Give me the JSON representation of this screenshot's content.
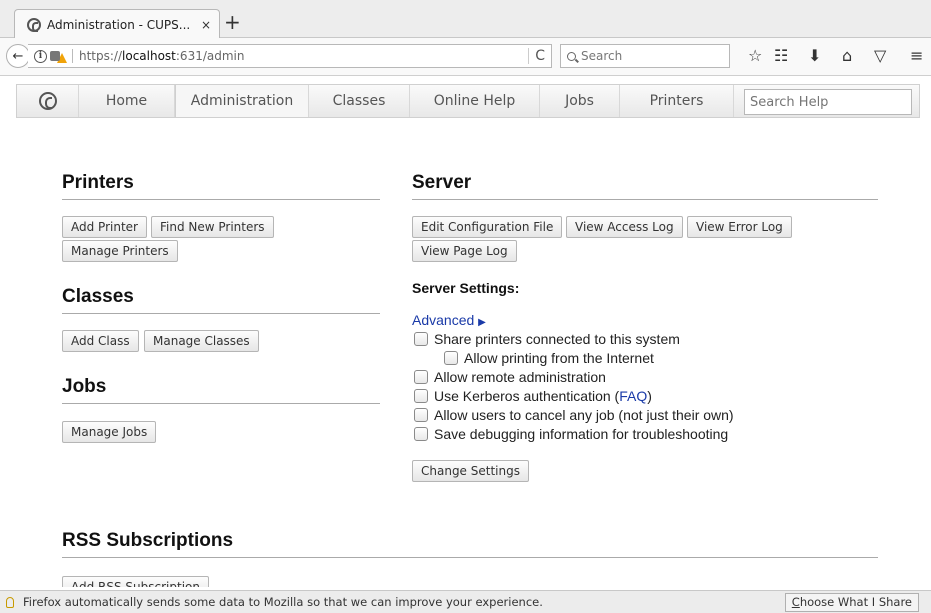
{
  "browser": {
    "tab_title": "Administration - CUPS...",
    "tab_close": "×",
    "new_tab": "+",
    "back": "🡐",
    "url_host": "localhost",
    "url_prefix": "https://",
    "url_suffix": ":631/admin",
    "reload": "C",
    "search_placeholder": "Search",
    "toolbar_icons": [
      "star-icon",
      "reading-list-icon",
      "download-icon",
      "home-icon",
      "pocket-icon",
      "menu-icon"
    ]
  },
  "cups_nav": {
    "tabs": [
      "Home",
      "Administration",
      "Classes",
      "Online Help",
      "Jobs",
      "Printers"
    ],
    "active": "Administration",
    "search_placeholder": "Search Help"
  },
  "printers": {
    "heading": "Printers",
    "buttons": [
      "Add Printer",
      "Find New Printers",
      "Manage Printers"
    ]
  },
  "classes": {
    "heading": "Classes",
    "buttons": [
      "Add Class",
      "Manage Classes"
    ]
  },
  "jobs": {
    "heading": "Jobs",
    "buttons": [
      "Manage Jobs"
    ]
  },
  "server": {
    "heading": "Server",
    "buttons": [
      "Edit Configuration File",
      "View Access Log",
      "View Error Log",
      "View Page Log"
    ],
    "settings_heading": "Server Settings:",
    "advanced_link": "Advanced",
    "advanced_arrow": "▶",
    "options": [
      "Share printers connected to this system",
      "Allow printing from the Internet",
      "Allow remote administration",
      "Use Kerberos authentication (",
      "Allow users to cancel any job (not just their own)",
      "Save debugging information for troubleshooting"
    ],
    "faq_link": "FAQ",
    "kerberos_close": ")",
    "change_button": "Change Settings"
  },
  "rss": {
    "heading": "RSS Subscriptions",
    "button": "Add RSS Subscription"
  },
  "notification": {
    "text": "Firefox automatically sends some data to Mozilla so that we can improve your experience.",
    "button_accel": "C",
    "button_rest": "hoose What I Share"
  }
}
